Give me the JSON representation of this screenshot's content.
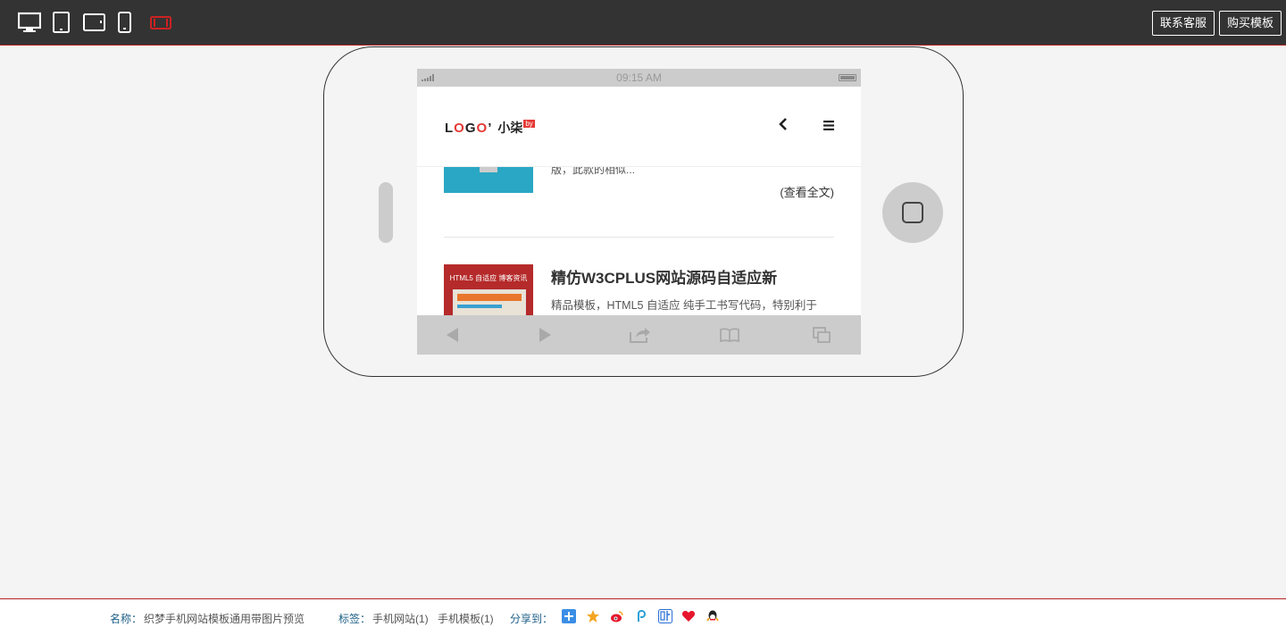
{
  "toolbar": {
    "devices": [
      {
        "name": "desktop",
        "icon": "desktop-icon",
        "active": false
      },
      {
        "name": "tablet-portrait",
        "icon": "tablet-portrait-icon",
        "active": false
      },
      {
        "name": "tablet-landscape",
        "icon": "tablet-landscape-icon",
        "active": false
      },
      {
        "name": "phone-portrait",
        "icon": "phone-portrait-icon",
        "active": false
      },
      {
        "name": "phone-landscape",
        "icon": "phone-landscape-icon",
        "active": true
      }
    ],
    "contact_label": "联系客服",
    "buy_label": "购买模板",
    "active_color": "#cc2222"
  },
  "phone": {
    "status_time": "09:15 AM",
    "logo": {
      "text": "LOGO",
      "suffix": "小柒",
      "badge": "by"
    },
    "article_prev": {
      "summary_tail": "版，此款的相似...",
      "read_more": "(查看全文)"
    },
    "article_next": {
      "thumb_caption": "HTML5 自适应 博客资讯",
      "title": "精仿W3CPLUS网站源码自适应新",
      "summary": "精品模板，HTML5 自适应 纯手工书写代码，特别利于"
    },
    "browser_icons": [
      "back-arrow-icon",
      "forward-arrow-icon",
      "share-icon",
      "bookmarks-icon",
      "tabs-icon"
    ]
  },
  "footer": {
    "name_label": "名称：",
    "name_value": "织梦手机网站模板通用带图片预览",
    "tags_label": "标签：",
    "tags": [
      "手机网站(1)",
      "手机模板(1)"
    ],
    "share_label": "分享到：",
    "share_icons": [
      "qzone-plus-icon",
      "favorite-star-icon",
      "weibo-icon",
      "pengyou-icon",
      "tieba-icon",
      "heart-icon",
      "qq-icon"
    ]
  }
}
